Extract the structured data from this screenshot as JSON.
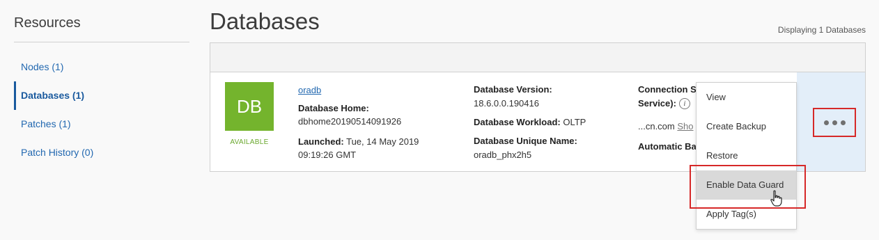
{
  "sidebar": {
    "title": "Resources",
    "items": [
      {
        "label": "Nodes (1)",
        "active": false
      },
      {
        "label": "Databases (1)",
        "active": true
      },
      {
        "label": "Patches (1)",
        "active": false
      },
      {
        "label": "Patch History (0)",
        "active": false
      }
    ]
  },
  "main": {
    "title": "Databases",
    "displaying": "Displaying 1 Databases"
  },
  "database": {
    "tile_text": "DB",
    "status": "AVAILABLE",
    "name": "oradb",
    "home_label": "Database Home:",
    "home_value": "dbhome20190514091926",
    "launched_label": "Launched:",
    "launched_value_line1": " Tue, 14 May 2019",
    "launched_value_line2": "09:19:26 GMT",
    "version_label": "Database Version:",
    "version_value": "18.6.0.0.190416",
    "workload_label": "Database Workload:",
    "workload_value": " OLTP",
    "unique_name_label": "Database Unique Name:",
    "unique_name_value": "oradb_phx2h5",
    "connection_label_line1": "Connection S",
    "connection_label_line2": "Service):",
    "connection_value": "...cn.com",
    "show_link": "Sho",
    "automatic_label": "Automatic Ba"
  },
  "menu": {
    "items": [
      "View",
      "Create Backup",
      "Restore",
      "Enable Data Guard",
      "Apply Tag(s)"
    ]
  },
  "colors": {
    "accent": "#2268b0",
    "tile": "#74b42d",
    "highlight": "#d62828"
  }
}
